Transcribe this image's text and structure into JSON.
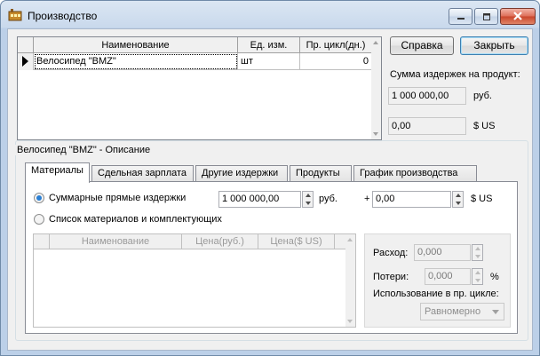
{
  "window": {
    "title": "Производство"
  },
  "grid": {
    "headers": [
      "Наименование",
      "Ед. изм.",
      "Пр. цикл(дн.)"
    ],
    "rows": [
      {
        "name": "Велосипед \"BMZ\"",
        "unit": "шт",
        "cycle": "0"
      }
    ]
  },
  "buttons": {
    "help": "Справка",
    "close": "Закрыть"
  },
  "summary": {
    "label": "Сумма издержек на продукт:",
    "rub_value": "1 000 000,00",
    "rub_unit": "руб.",
    "usd_value": "0,00",
    "usd_unit": "$ US"
  },
  "group": {
    "title": "Велосипед \"BMZ\" - Описание"
  },
  "tabs": [
    "Материалы",
    "Сдельная зарплата",
    "Другие издержки",
    "Продукты",
    "График производства"
  ],
  "materials": {
    "option_total": "Суммарные прямые издержки",
    "total_rub": "1 000 000,00",
    "rub_unit": "руб.",
    "plus": "+",
    "total_usd": "0,00",
    "usd_unit": "$ US",
    "option_list": "Список материалов и комплектующих",
    "list_headers": [
      "Наименование",
      "Цена(руб.)",
      "Цена($ US)"
    ],
    "consumption_label": "Расход:",
    "consumption_value": "0,000",
    "losses_label": "Потери:",
    "losses_value": "0,000",
    "losses_unit": "%",
    "usage_label": "Использование в пр. цикле:",
    "usage_value": "Равномерно"
  },
  "colors": {
    "titlebar": "#c9d9ec",
    "client": "#f0f0f0",
    "accent": "#2a7fd4",
    "close": "#c9452b"
  }
}
